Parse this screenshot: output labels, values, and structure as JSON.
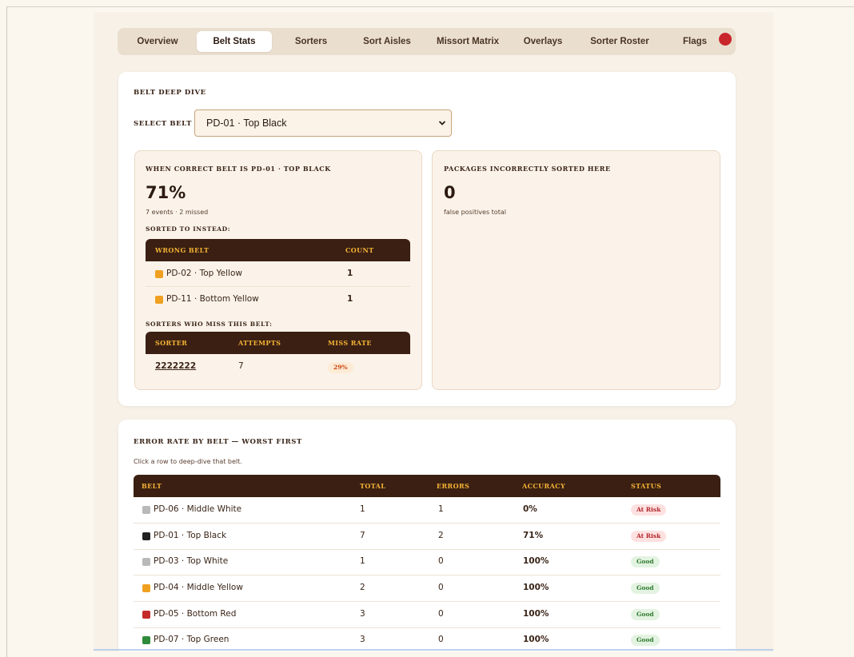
{
  "nav": {
    "tabs": [
      "Overview",
      "Belt Stats",
      "Sorters",
      "Sort Aisles",
      "Missort Matrix",
      "Overlays",
      "Sorter Roster",
      "Flags"
    ],
    "active": "Belt Stats"
  },
  "deep_dive": {
    "title": "BELT DEEP DIVE",
    "select_label": "SELECT BELT",
    "selected_belt": "PD-01 · Top Black",
    "left": {
      "heading": "WHEN CORRECT BELT IS PD-01 · TOP BLACK",
      "accuracy": "71%",
      "events_text": "7 events · 2 missed",
      "sorted_to_label": "SORTED TO INSTEAD:",
      "wrong_table": {
        "headers": [
          "WRONG BELT",
          "COUNT"
        ],
        "rows": [
          {
            "belt": "PD-02 · Top Yellow",
            "count": "1",
            "color": "#f0a020"
          },
          {
            "belt": "PD-11 · Bottom Yellow",
            "count": "1",
            "color": "#f0a020"
          }
        ]
      },
      "sorters_label": "SORTERS WHO MISS THIS BELT:",
      "sorter_table": {
        "headers": [
          "SORTER",
          "ATTEMPTS",
          "MISS RATE"
        ],
        "rows": [
          {
            "sorter": "2222222",
            "attempts": "7",
            "miss_rate": "29%"
          }
        ]
      }
    },
    "right": {
      "heading": "PACKAGES INCORRECTLY SORTED HERE",
      "value": "0",
      "caption": "false positives total"
    }
  },
  "error_rate": {
    "title": "ERROR RATE BY BELT — WORST FIRST",
    "hint": "Click a row to deep-dive that belt.",
    "headers": [
      "BELT",
      "TOTAL",
      "ERRORS",
      "ACCURACY",
      "STATUS"
    ],
    "rows": [
      {
        "belt": "PD-06 · Middle White",
        "color": "#b9b9b9",
        "total": "1",
        "errors": "1",
        "accuracy": "0%",
        "status": "At Risk"
      },
      {
        "belt": "PD-01 · Top Black",
        "color": "#222222",
        "total": "7",
        "errors": "2",
        "accuracy": "71%",
        "status": "At Risk"
      },
      {
        "belt": "PD-03 · Top White",
        "color": "#b9b9b9",
        "total": "1",
        "errors": "0",
        "accuracy": "100%",
        "status": "Good"
      },
      {
        "belt": "PD-04 · Middle Yellow",
        "color": "#f0a020",
        "total": "2",
        "errors": "0",
        "accuracy": "100%",
        "status": "Good"
      },
      {
        "belt": "PD-05 · Bottom Red",
        "color": "#c52a2a",
        "total": "3",
        "errors": "0",
        "accuracy": "100%",
        "status": "Good"
      },
      {
        "belt": "PD-07 · Top Green",
        "color": "#2e8b3a",
        "total": "3",
        "errors": "0",
        "accuracy": "100%",
        "status": "Good"
      }
    ]
  }
}
